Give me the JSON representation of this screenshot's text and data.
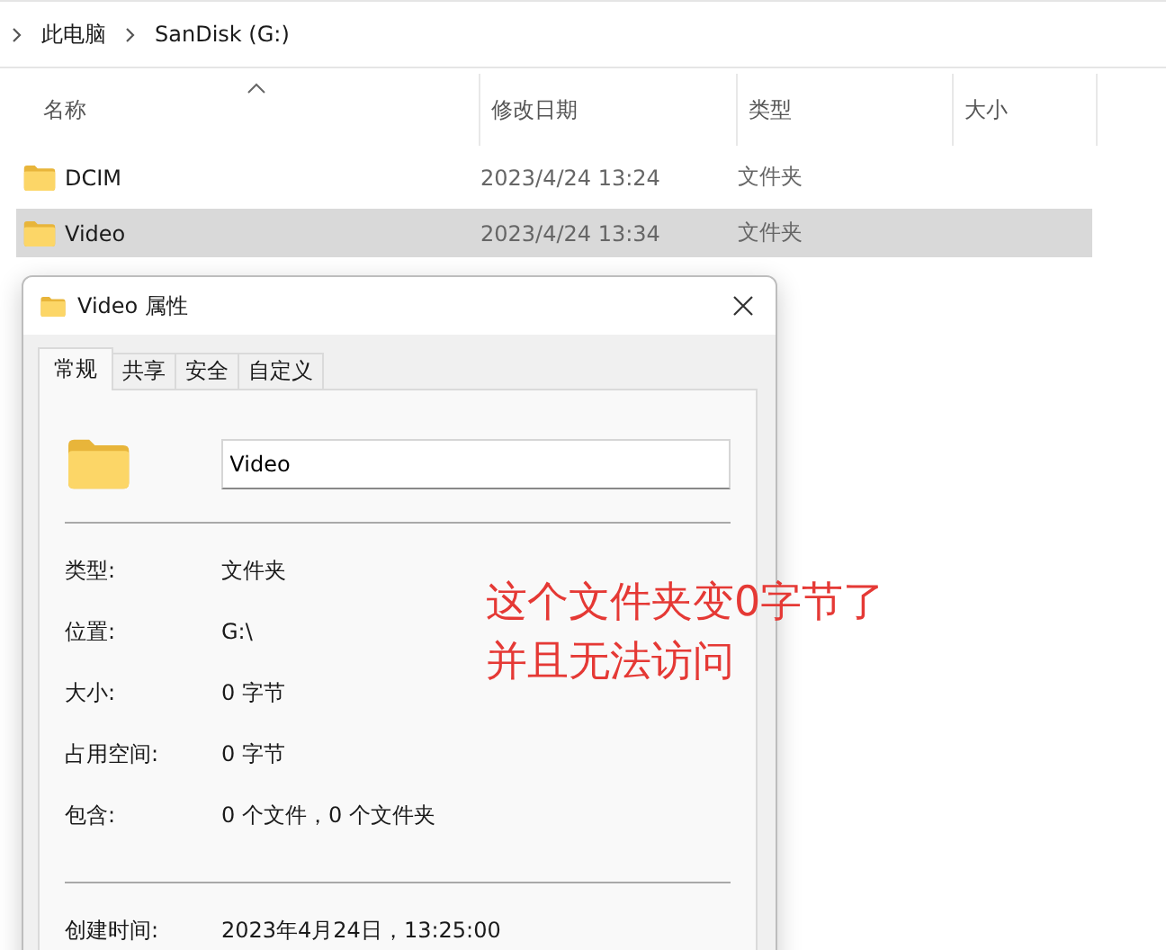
{
  "breadcrumb": [
    "此电脑",
    "SanDisk (G:)"
  ],
  "file_list": {
    "columns": [
      {
        "label": "名称",
        "sorted": true
      },
      {
        "label": "修改日期",
        "sorted": false
      },
      {
        "label": "类型",
        "sorted": false
      },
      {
        "label": "大小",
        "sorted": false
      }
    ],
    "rows": [
      {
        "name": "DCIM",
        "modified": "2023/4/24 13:24",
        "type": "文件夹",
        "selected": false
      },
      {
        "name": "Video",
        "modified": "2023/4/24 13:34",
        "type": "文件夹",
        "selected": true
      }
    ]
  },
  "dialog": {
    "title": "Video 属性",
    "tabs": [
      {
        "label": "常规",
        "selected": true
      },
      {
        "label": "共享",
        "selected": false
      },
      {
        "label": "安全",
        "selected": false
      },
      {
        "label": "自定义",
        "selected": false
      }
    ],
    "name_value": "Video",
    "property_groups": [
      [
        {
          "label": "类型:",
          "value": "文件夹"
        },
        {
          "label": "位置:",
          "value": "G:\\"
        },
        {
          "label": "大小:",
          "value": "0 字节"
        },
        {
          "label": "占用空间:",
          "value": "0 字节"
        },
        {
          "label": "包含:",
          "value": "0 个文件，0 个文件夹"
        }
      ],
      [
        {
          "label": "创建时间:",
          "value": "2023年4月24日，13:25:00"
        }
      ]
    ]
  },
  "annotation": [
    "这个文件夹变0字节了",
    "并且无法访问"
  ]
}
